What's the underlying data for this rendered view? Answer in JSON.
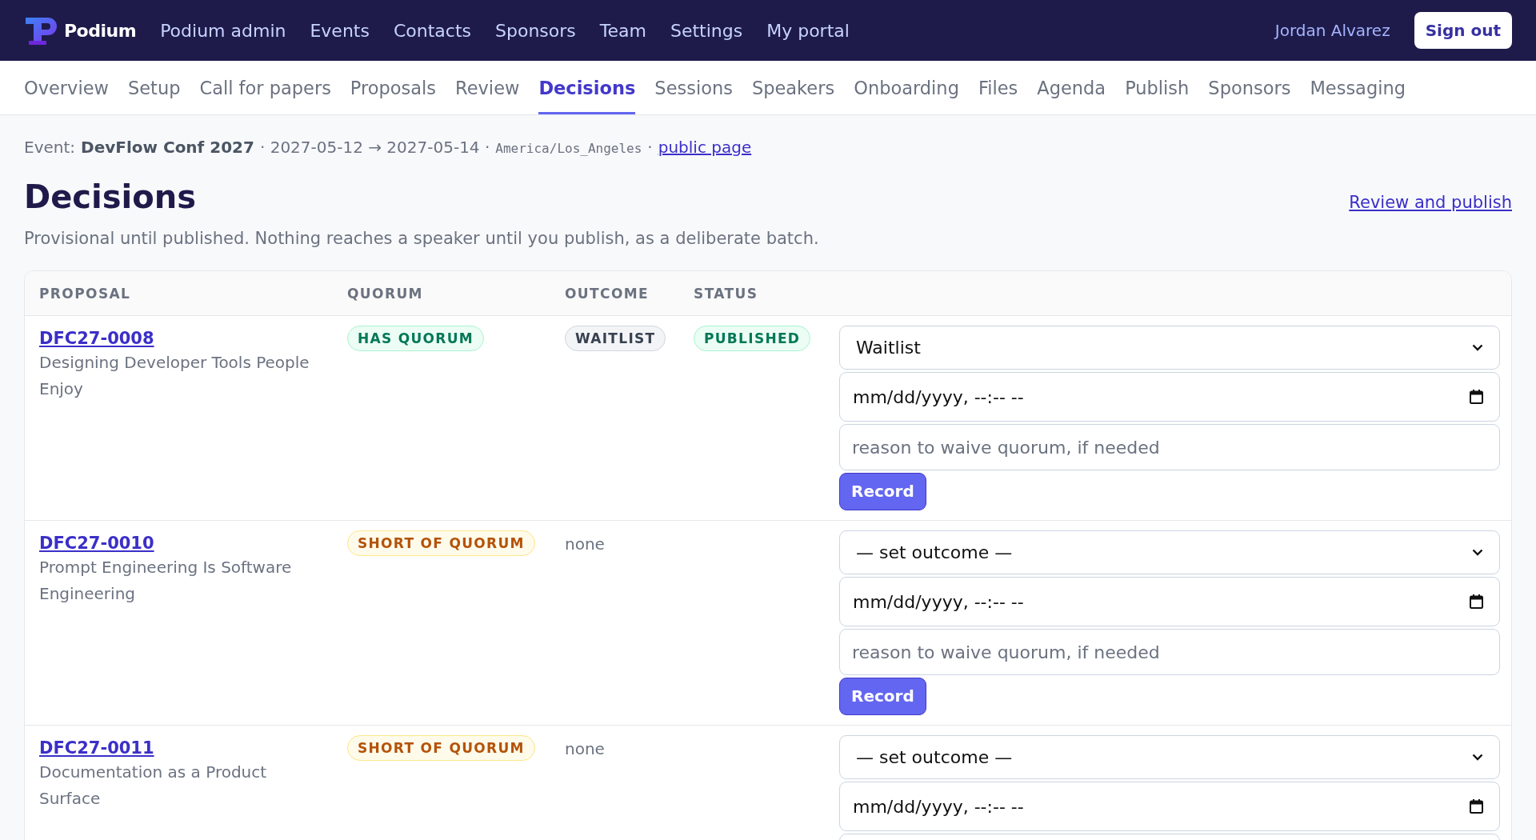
{
  "topbar": {
    "brand": "Podium",
    "nav": [
      "Podium admin",
      "Events",
      "Contacts",
      "Sponsors",
      "Team",
      "Settings",
      "My portal"
    ],
    "user": "Jordan Alvarez",
    "sign_out": "Sign out"
  },
  "tabs": [
    {
      "label": "Overview",
      "selected": false
    },
    {
      "label": "Setup",
      "selected": false
    },
    {
      "label": "Call for papers",
      "selected": false
    },
    {
      "label": "Proposals",
      "selected": false
    },
    {
      "label": "Review",
      "selected": false
    },
    {
      "label": "Decisions",
      "selected": true
    },
    {
      "label": "Sessions",
      "selected": false
    },
    {
      "label": "Speakers",
      "selected": false
    },
    {
      "label": "Onboarding",
      "selected": false
    },
    {
      "label": "Files",
      "selected": false
    },
    {
      "label": "Agenda",
      "selected": false
    },
    {
      "label": "Publish",
      "selected": false
    },
    {
      "label": "Sponsors",
      "selected": false
    },
    {
      "label": "Messaging",
      "selected": false
    }
  ],
  "event_line": {
    "prefix": "Event:",
    "name": "DevFlow Conf 2027",
    "dates": "· 2027-05-12 → 2027-05-14 ·",
    "timezone": "America/Los_Angeles",
    "separator": "·",
    "link": "public page"
  },
  "page": {
    "title": "Decisions",
    "action_link": "Review and publish",
    "subtitle": "Provisional until published. Nothing reaches a speaker until you publish, as a deliberate batch."
  },
  "table": {
    "columns": [
      "PROPOSAL",
      "QUORUM",
      "OUTCOME",
      "STATUS"
    ],
    "rows": [
      {
        "id": "DFC27-0008",
        "title": "Designing Developer Tools People Enjoy",
        "quorum": {
          "text": "HAS QUORUM",
          "kind": "met"
        },
        "outcome": {
          "text": "WAITLIST",
          "kind": "badge"
        },
        "status": {
          "text": "PUBLISHED",
          "kind": "published"
        },
        "outcome_select": {
          "value": "Waitlist"
        },
        "date_field": {
          "placeholder": "mm/dd/yyyy, --:-- --"
        },
        "reason_field": {
          "placeholder": "reason to waive quorum, if needed"
        },
        "record_button": "Record"
      },
      {
        "id": "DFC27-0010",
        "title": "Prompt Engineering Is Software Engineering",
        "quorum": {
          "text": "SHORT OF QUORUM",
          "kind": "short"
        },
        "outcome": {
          "text": "none",
          "kind": "plain"
        },
        "outcome_select": {
          "value": "— set outcome —"
        },
        "date_field": {
          "placeholder": "mm/dd/yyyy, --:-- --"
        },
        "reason_field": {
          "placeholder": "reason to waive quorum, if needed"
        },
        "record_button": "Record"
      },
      {
        "id": "DFC27-0011",
        "title": "Documentation as a Product Surface",
        "quorum": {
          "text": "SHORT OF QUORUM",
          "kind": "short"
        },
        "outcome": {
          "text": "none",
          "kind": "plain"
        },
        "outcome_select": {
          "value": "— set outcome —"
        },
        "date_field": {
          "placeholder": "mm/dd/yyyy, --:-- --"
        },
        "reason_field": {
          "cut_off": true
        }
      }
    ]
  }
}
